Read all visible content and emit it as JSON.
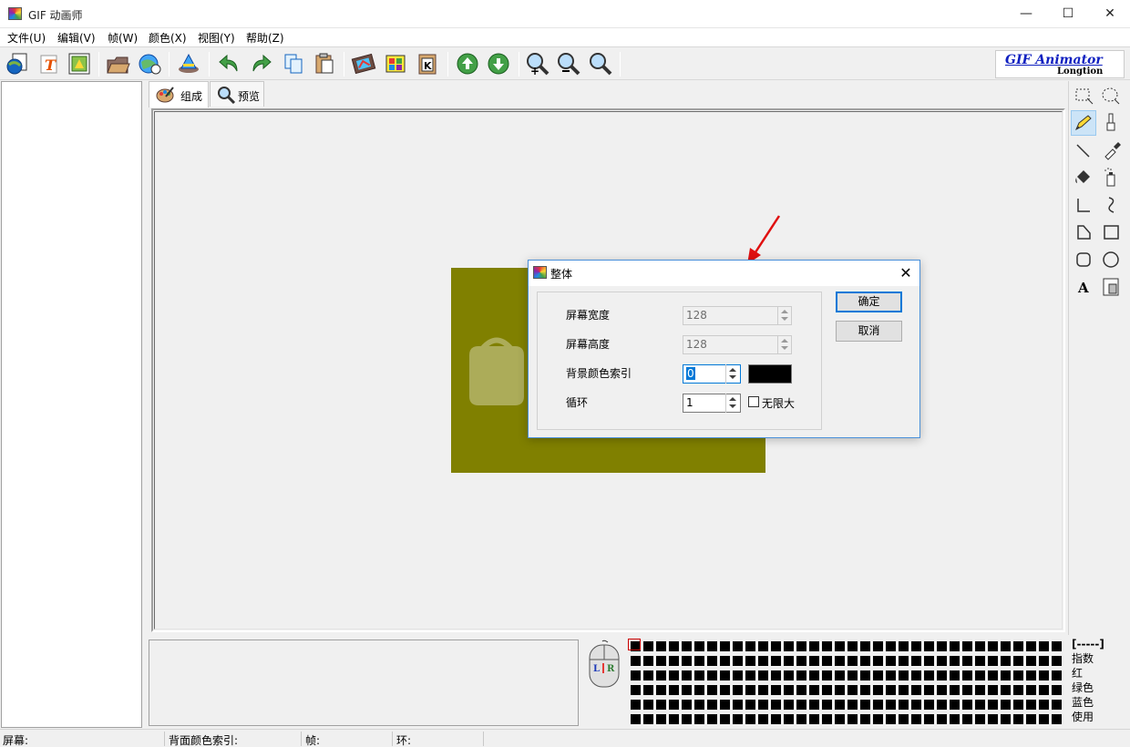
{
  "window": {
    "title": "GIF 动画师",
    "min": "—",
    "max": "☐",
    "close": "✕"
  },
  "menu": [
    "文件(U)",
    "编辑(V)",
    "帧(W)",
    "颜色(X)",
    "视图(Y)",
    "帮助(Z)"
  ],
  "logo": {
    "line1": "GIF Animator",
    "line2": "Longtion"
  },
  "tabs": [
    {
      "label": "组成"
    },
    {
      "label": "预览"
    }
  ],
  "dialog": {
    "title": "整体",
    "close": "✕",
    "screen_width_label": "屏幕宽度",
    "screen_width_value": "128",
    "screen_height_label": "屏幕高度",
    "screen_height_value": "128",
    "bg_color_index_label": "背景颜色索引",
    "bg_color_index_value": "0",
    "bg_color": "#000000",
    "loop_label": "循环",
    "loop_value": "1",
    "infinite_label": "无限大",
    "ok": "确定",
    "cancel": "取消"
  },
  "info_labels": [
    "[-----]",
    "指数",
    "红",
    "绿色",
    "蓝色",
    "使用"
  ],
  "mouse": {
    "left": "L",
    "right": "R"
  },
  "status": {
    "screen": "屏幕:",
    "bg_index": "背面颜色索引:",
    "frame": "帧:",
    "loop": "环:"
  },
  "colors": {
    "canvas_fill": "#808000",
    "accent": "#0078d7"
  }
}
